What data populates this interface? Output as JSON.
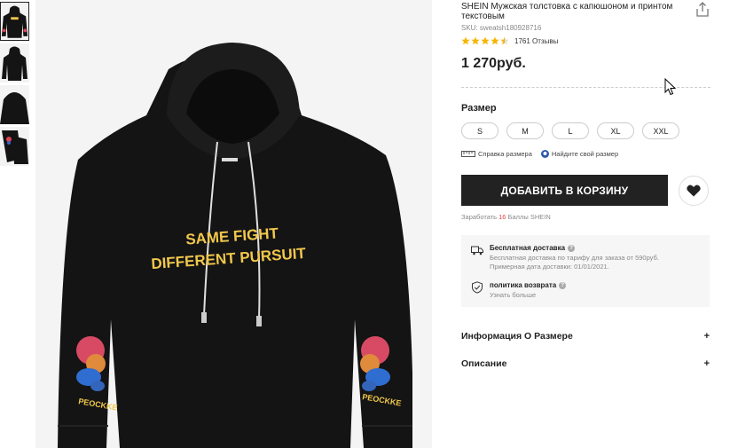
{
  "product": {
    "title": "SHEIN Мужская толстовка с капюшоном и принтом текстовым",
    "sku": "SKU: sweatsh180928716",
    "rating": 4.5,
    "reviews": "1761 Отзывы",
    "price": "1 270руб.",
    "print_text_line1": "SAME FIGHT",
    "print_text_line2": "DIFFERENT PURSUIT",
    "sleeve_text": "PEOCKKE"
  },
  "size": {
    "label": "Размер",
    "options": [
      "S",
      "M",
      "L",
      "XL",
      "XXL"
    ],
    "guide_link": "Справка размера",
    "find_link": "Найдите свой размер"
  },
  "actions": {
    "add_to_cart": "ДОБАВИТЬ В КОРЗИНУ",
    "points_prefix": "Заработать ",
    "points_value": "16",
    "points_suffix": " Баллы SHEIN"
  },
  "delivery": {
    "free_title": "Бесплатная доставка",
    "free_text": "Бесплатная доставка по тарифу для заказа от 590руб. Примерная дата доставки: 01/01/2021.",
    "return_title": "политика возврата",
    "return_link": "Узнать больше"
  },
  "accordion": {
    "size_info": "Информация О Размере",
    "description": "Описание",
    "expand_symbol": "+"
  },
  "icons": {
    "share": "share-icon",
    "star": "star-icon",
    "ruler": "ruler-icon",
    "find_size": "find-size-icon",
    "heart": "heart-icon",
    "truck": "truck-icon",
    "shield": "shield-check-icon",
    "question": "question-icon"
  },
  "colors": {
    "star": "#f7b500",
    "button": "#222222",
    "accent": "#e64545",
    "garment": "#141414",
    "print_yellow": "#f2c84b"
  }
}
